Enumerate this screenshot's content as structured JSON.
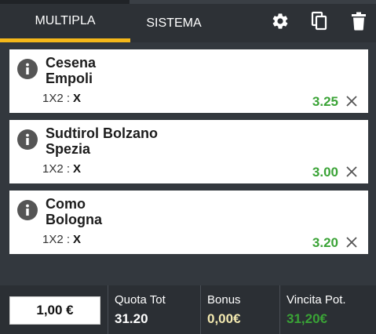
{
  "tabs": [
    {
      "label": "MULTIPLA",
      "active": true
    },
    {
      "label": "SISTEMA",
      "active": false
    }
  ],
  "header_icons": [
    "gear-icon",
    "copy-icon",
    "trash-icon"
  ],
  "bets": [
    {
      "home": "Cesena",
      "away": "Empoli",
      "market": "1X2 :",
      "pick": "X",
      "odds": "3.25"
    },
    {
      "home": "Sudtirol Bolzano",
      "away": "Spezia",
      "market": "1X2 :",
      "pick": "X",
      "odds": "3.00"
    },
    {
      "home": "Como",
      "away": "Bologna",
      "market": "1X2 :",
      "pick": "X",
      "odds": "3.20"
    }
  ],
  "footer": {
    "stake": "1,00 €",
    "quota_label": "Quota Tot",
    "quota_value": "31.20",
    "bonus_label": "Bonus",
    "bonus_value": "0,00€",
    "vincita_label": "Vincita Pot.",
    "vincita_value": "31,20€"
  },
  "colors": {
    "accent": "#f5b81a",
    "odds_green": "#3aa336",
    "background": "#33383e"
  }
}
